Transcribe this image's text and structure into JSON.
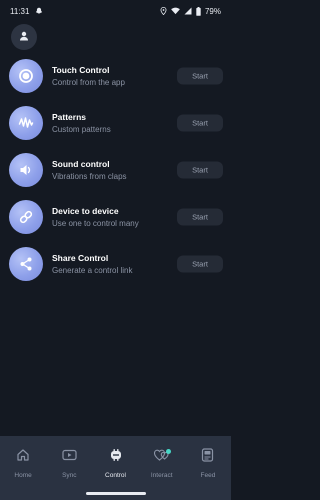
{
  "status": {
    "time": "11:31",
    "battery": "79%"
  },
  "features": [
    {
      "title": "Touch Control",
      "subtitle": "Control from the app",
      "icon": "touch-icon",
      "button": "Start"
    },
    {
      "title": "Patterns",
      "subtitle": "Custom patterns",
      "icon": "wave-icon",
      "button": "Start"
    },
    {
      "title": "Sound control",
      "subtitle": "Vibrations from claps",
      "icon": "speaker-icon",
      "button": "Start"
    },
    {
      "title": "Device to device",
      "subtitle": "Use one to control many",
      "icon": "link-icon",
      "button": "Start"
    },
    {
      "title": "Share Control",
      "subtitle": "Generate a control link",
      "icon": "share-icon",
      "button": "Start"
    }
  ],
  "nav": [
    {
      "label": "Home",
      "icon": "home-icon"
    },
    {
      "label": "Sync",
      "icon": "play-icon"
    },
    {
      "label": "Control",
      "icon": "control-icon",
      "active": true
    },
    {
      "label": "Interact",
      "icon": "hearts-icon"
    },
    {
      "label": "Feed",
      "icon": "feed-icon"
    }
  ],
  "colors": {
    "background": "#141922",
    "accent": "#8ea0ea",
    "nav_bg": "#2a3241",
    "notify_dot": "#47d7c6"
  }
}
